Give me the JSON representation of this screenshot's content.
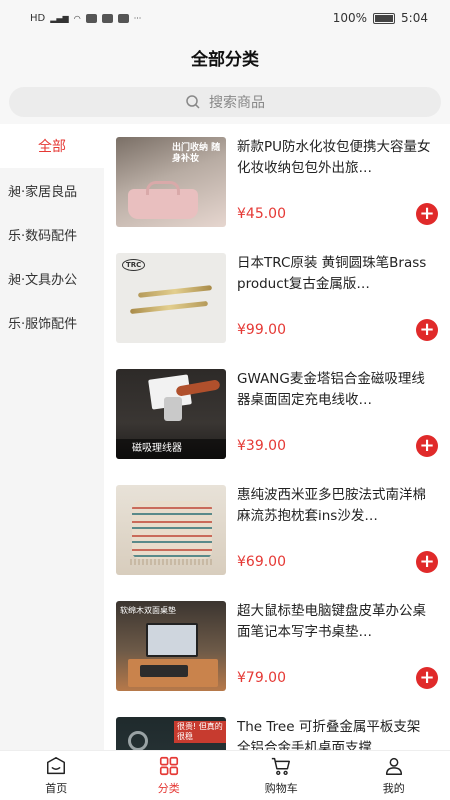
{
  "status": {
    "left_text": "HD",
    "battery": "100%",
    "time": "5:04"
  },
  "header": {
    "title": "全部分类"
  },
  "search": {
    "placeholder": "搜索商品"
  },
  "sidebar": {
    "items": [
      {
        "label": "全部",
        "active": true
      },
      {
        "label": "昶·家居良品",
        "active": false
      },
      {
        "label": "乐·数码配件",
        "active": false
      },
      {
        "label": "昶·文具办公",
        "active": false
      },
      {
        "label": "乐·服饰配件",
        "active": false
      }
    ]
  },
  "products": [
    {
      "name": "新款PU防水化妆包便携大容量女化妆收纳包包外出旅…",
      "price": "¥45.00",
      "thumb_text": "出门收纳 随身补妆"
    },
    {
      "name": "日本TRC原装 黄铜圆珠笔Brass product复古金属版…",
      "price": "¥99.00",
      "thumb_text": "TRC"
    },
    {
      "name": "GWANG麦金塔铝合金磁吸理线器桌面固定充电线收…",
      "price": "¥39.00",
      "thumb_text": "磁吸理线器"
    },
    {
      "name": "惠纯波西米亚多巴胺法式南洋棉麻流苏抱枕套ins沙发…",
      "price": "¥69.00",
      "thumb_text": ""
    },
    {
      "name": "超大鼠标垫电脑键盘皮革办公桌面笔记本写字书桌垫…",
      "price": "¥79.00",
      "thumb_text": "软绵木双面桌垫"
    },
    {
      "name": "The Tree 可折叠金属平板支架 全铝合金手机桌面支撑…",
      "price": "",
      "thumb_text": "很贵! 但真的很稳"
    }
  ],
  "tabbar": {
    "tabs": [
      {
        "label": "首页",
        "icon": "home-icon"
      },
      {
        "label": "分类",
        "icon": "category-icon"
      },
      {
        "label": "购物车",
        "icon": "cart-icon"
      },
      {
        "label": "我的",
        "icon": "user-icon"
      }
    ]
  },
  "colors": {
    "accent": "#e53935",
    "sidebar_bg": "#f5f5f5"
  }
}
